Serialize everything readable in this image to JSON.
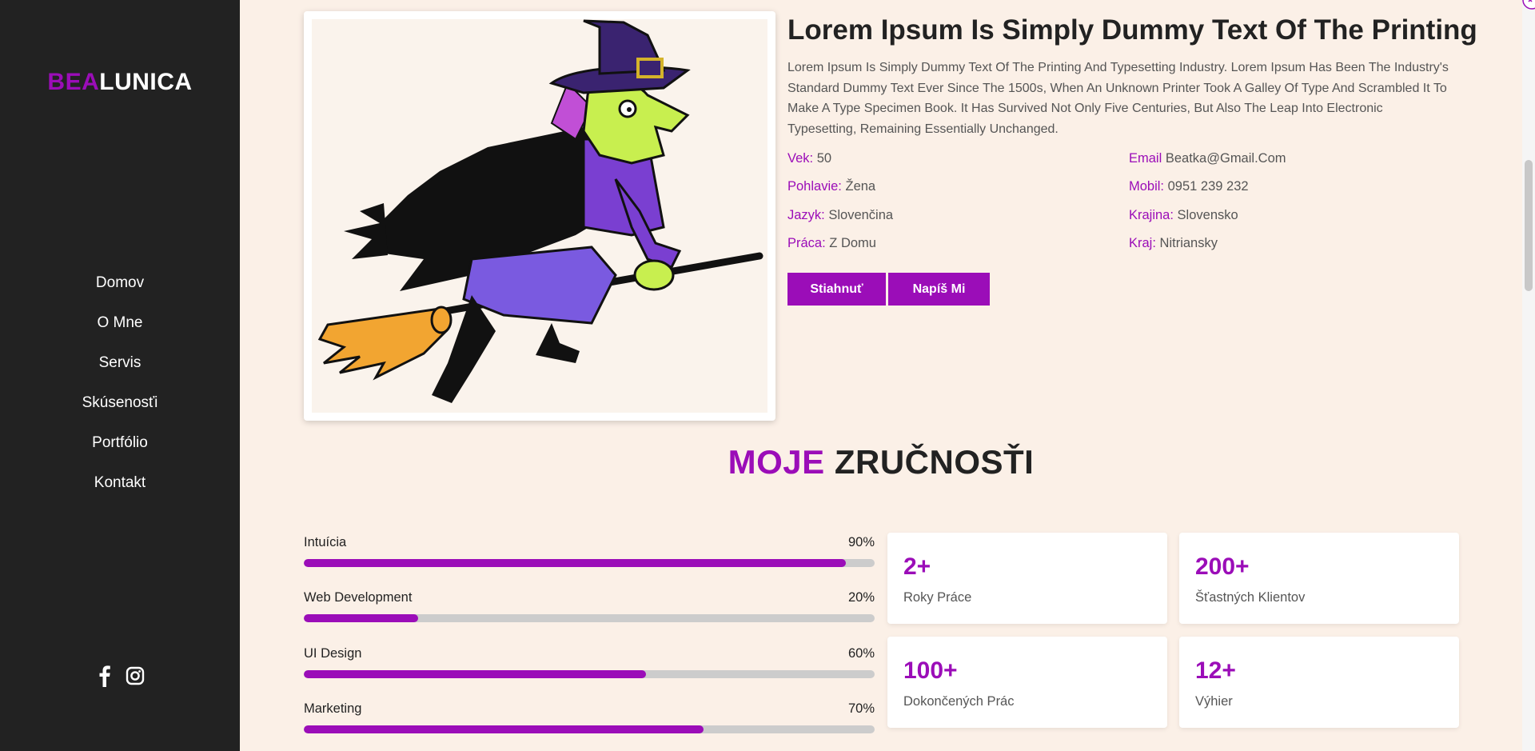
{
  "brand": {
    "part1": "BEA",
    "part2": "LUNICA"
  },
  "nav": [
    {
      "label": "Domov"
    },
    {
      "label": "O Mne"
    },
    {
      "label": "Servis"
    },
    {
      "label": "Skúsenosťi"
    },
    {
      "label": "Portfólio"
    },
    {
      "label": "Kontakt"
    }
  ],
  "social": [
    "facebook-icon",
    "instagram-icon"
  ],
  "about": {
    "title": "Lorem Ipsum Is Simply Dummy Text Of The Printing",
    "text": "Lorem Ipsum Is Simply Dummy Text Of The Printing And Typesetting Industry. Lorem Ipsum Has Been The Industry's Standard Dummy Text Ever Since The 1500s, When An Unknown Printer Took A Galley Of Type And Scrambled It To Make A Type Specimen Book. It Has Survived Not Only Five Centuries, But Also The Leap Into Electronic Typesetting, Remaining Essentially Unchanged.",
    "info_left": [
      {
        "key": "Vek:",
        "value": "50"
      },
      {
        "key": "Pohlavie:",
        "value": "Žena"
      },
      {
        "key": "Jazyk:",
        "value": "Slovenčina"
      },
      {
        "key": "Práca:",
        "value": "Z Domu"
      }
    ],
    "info_right": [
      {
        "key": "Email",
        "value": "Beatka@Gmail.Com"
      },
      {
        "key": "Mobil:",
        "value": "0951 239 232"
      },
      {
        "key": "Krajina:",
        "value": "Slovensko"
      },
      {
        "key": "Kraj:",
        "value": "Nitriansky"
      }
    ],
    "buttons": {
      "download": "Stiahnuť",
      "write": "Napíš Mi"
    }
  },
  "skills": {
    "title_accent": "MOJE",
    "title_rest": "ZRUČNOSŤI",
    "items": [
      {
        "name": "Intuícia",
        "percent_label": "90%",
        "value": 0.95
      },
      {
        "name": "Web Development",
        "percent_label": "20%",
        "value": 0.2
      },
      {
        "name": "UI Design",
        "percent_label": "60%",
        "value": 0.6
      },
      {
        "name": "Marketing",
        "percent_label": "70%",
        "value": 0.7
      }
    ]
  },
  "stats": [
    {
      "number": "2+",
      "label": "Roky Práce"
    },
    {
      "number": "200+",
      "label": "Šťastných Klientov"
    },
    {
      "number": "100+",
      "label": "Dokončených Prác"
    },
    {
      "number": "12+",
      "label": "Výhier"
    }
  ],
  "colors": {
    "accent": "#9b0db8",
    "sidebar": "#222222",
    "background": "#fbf0e7"
  }
}
